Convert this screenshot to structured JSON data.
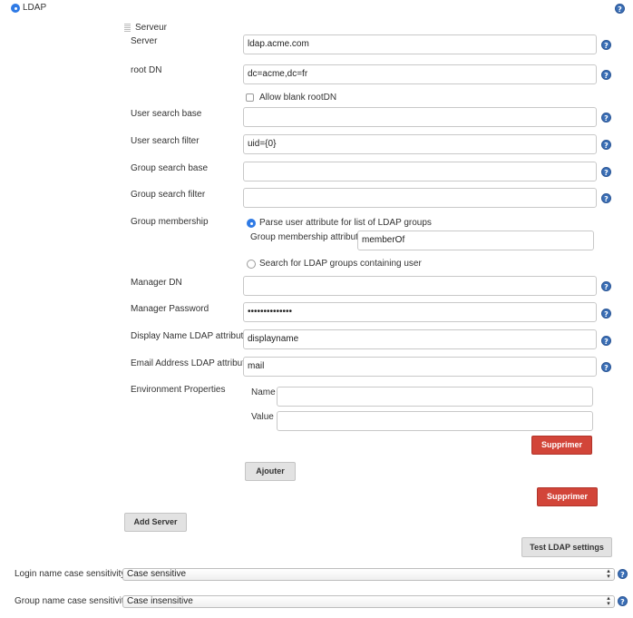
{
  "section": {
    "title": "LDAP"
  },
  "server_block": {
    "heading": "Serveur"
  },
  "fields": {
    "server": {
      "label": "Server",
      "value": "ldap.acme.com"
    },
    "root_dn": {
      "label": "root DN",
      "value": "dc=acme,dc=fr"
    },
    "allow_blank": {
      "label": "Allow blank rootDN",
      "checked": false
    },
    "user_search_base": {
      "label": "User search base",
      "value": ""
    },
    "user_search_filter": {
      "label": "User search filter",
      "value": "uid={0}"
    },
    "group_search_base": {
      "label": "Group search base",
      "value": ""
    },
    "group_search_filter": {
      "label": "Group search filter",
      "value": ""
    },
    "group_membership": {
      "label": "Group membership",
      "option_parse": "Parse user attribute for list of LDAP groups",
      "attribute_label": "Group membership attribute",
      "attribute_value": "memberOf",
      "option_search": "Search for LDAP groups containing user",
      "selected": "parse"
    },
    "manager_dn": {
      "label": "Manager DN",
      "value": ""
    },
    "manager_password": {
      "label": "Manager Password",
      "value": "••••••••••••••"
    },
    "display_name_attr": {
      "label": "Display Name LDAP attribute",
      "value": "displayname"
    },
    "email_attr": {
      "label": "Email Address LDAP attribute",
      "value": "mail"
    },
    "env_props": {
      "label": "Environment Properties",
      "name_label": "Name",
      "name_value": "",
      "value_label": "Value",
      "value_value": ""
    }
  },
  "buttons": {
    "supprimer_env": "Supprimer",
    "ajouter": "Ajouter",
    "supprimer_server": "Supprimer",
    "add_server": "Add Server",
    "test_ldap": "Test LDAP settings"
  },
  "case_sensitivity": {
    "login_label": "Login name case sensitivity",
    "login_value": "Case sensitive",
    "group_label": "Group name case sensitivity",
    "group_value": "Case insensitive"
  },
  "icons": {
    "help": "help-icon",
    "select_arrow": "select-arrows-icon"
  },
  "colors": {
    "accent": "#2f7ae5",
    "danger": "#d24539",
    "help": "#3b6fb6"
  }
}
